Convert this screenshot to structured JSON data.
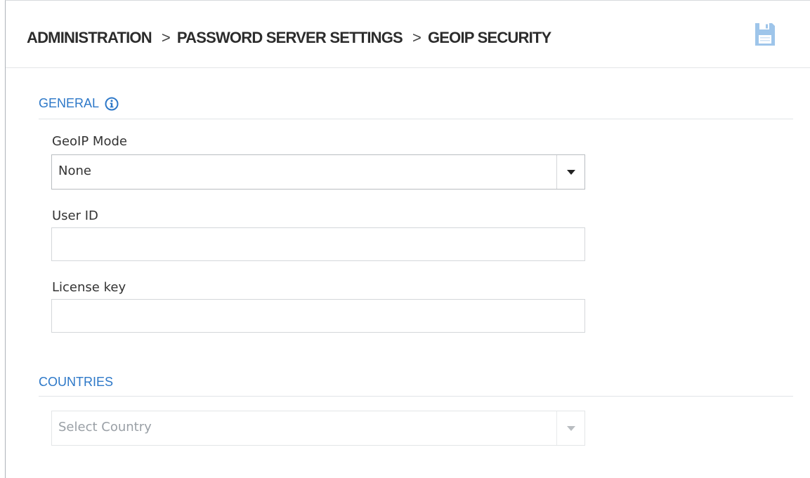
{
  "breadcrumb": {
    "items": [
      "ADMINISTRATION",
      "PASSWORD SERVER SETTINGS",
      "GEOIP SECURITY"
    ],
    "separator": ">"
  },
  "toolbar": {
    "save_icon": "floppy-disk-icon"
  },
  "general": {
    "title": "GENERAL",
    "info_icon": "info-circle-icon",
    "geoip_mode_label": "GeoIP Mode",
    "geoip_mode_value": "None",
    "user_id_label": "User ID",
    "user_id_value": "",
    "license_key_label": "License key",
    "license_key_value": ""
  },
  "countries": {
    "title": "COUNTRIES",
    "select_placeholder": "Select Country"
  },
  "colors": {
    "accent": "#2d78c8",
    "save_icon": "#9ec5ea",
    "text": "#333333"
  }
}
